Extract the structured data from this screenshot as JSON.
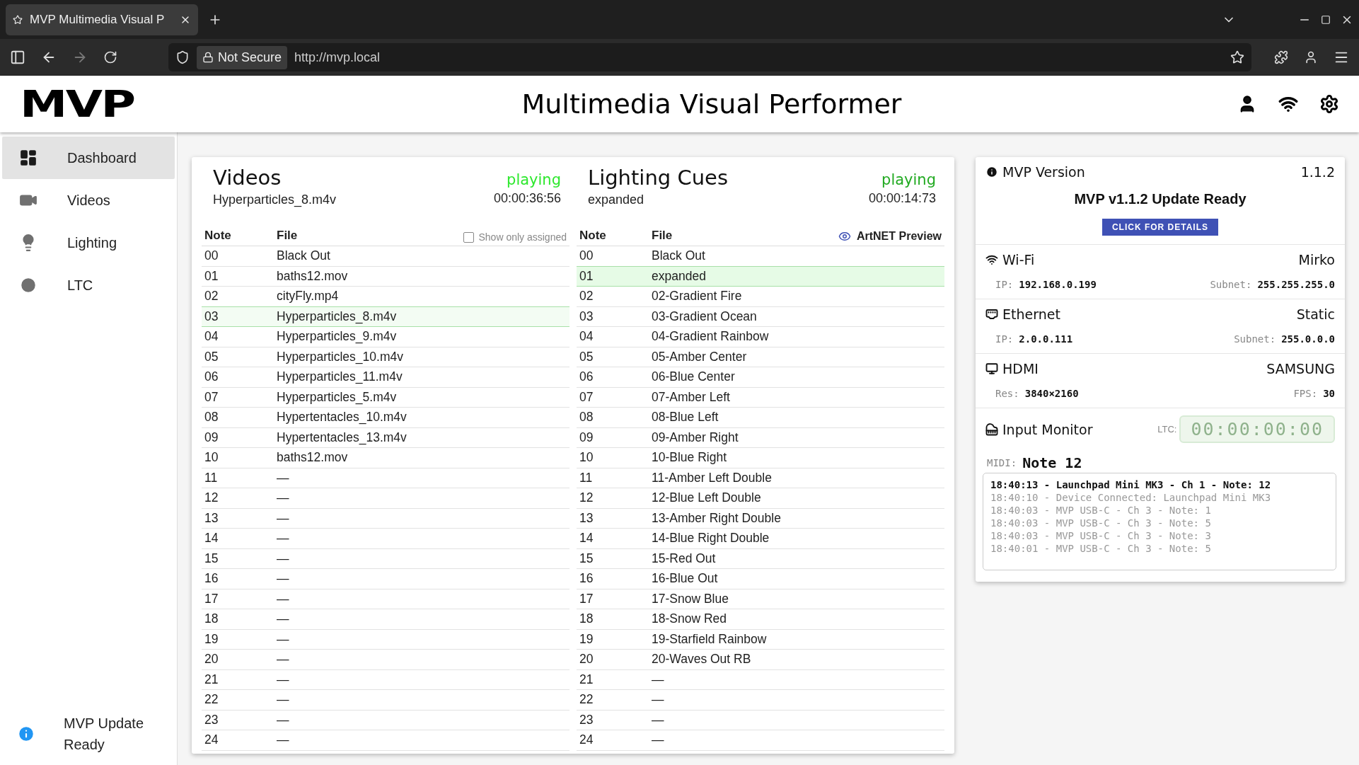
{
  "browser": {
    "tab_title": "MVP Multimedia Visual P",
    "security": "Not Secure",
    "url": "http://mvp.local"
  },
  "header": {
    "logo": "MVP",
    "title": "Multimedia Visual Performer"
  },
  "sidebar": {
    "items": [
      {
        "label": "Dashboard",
        "selected": true
      },
      {
        "label": "Videos",
        "selected": false
      },
      {
        "label": "Lighting",
        "selected": false
      },
      {
        "label": "LTC",
        "selected": false
      }
    ],
    "footer": "MVP Update Ready"
  },
  "videos": {
    "title": "Videos",
    "current": "Hyperparticles_8.m4v",
    "status": "playing",
    "time": "00:00:36:56",
    "columns": [
      "Note",
      "File"
    ],
    "filter": {
      "label": "Show only assigned",
      "checked": false
    },
    "rows": [
      {
        "note": "00",
        "file": "Black Out",
        "selected": false
      },
      {
        "note": "01",
        "file": "baths12.mov",
        "selected": false
      },
      {
        "note": "02",
        "file": "cityFly.mp4",
        "selected": false
      },
      {
        "note": "03",
        "file": "Hyperparticles_8.m4v",
        "selected": true
      },
      {
        "note": "04",
        "file": "Hyperparticles_9.m4v",
        "selected": false
      },
      {
        "note": "05",
        "file": "Hyperparticles_10.m4v",
        "selected": false
      },
      {
        "note": "06",
        "file": "Hyperparticles_11.m4v",
        "selected": false
      },
      {
        "note": "07",
        "file": "Hyperparticles_5.m4v",
        "selected": false
      },
      {
        "note": "08",
        "file": "Hypertentacles_10.m4v",
        "selected": false
      },
      {
        "note": "09",
        "file": "Hypertentacles_13.m4v",
        "selected": false
      },
      {
        "note": "10",
        "file": "baths12.mov",
        "selected": false
      },
      {
        "note": "11",
        "file": "—",
        "selected": false
      },
      {
        "note": "12",
        "file": "—",
        "selected": false
      },
      {
        "note": "13",
        "file": "—",
        "selected": false
      },
      {
        "note": "14",
        "file": "—",
        "selected": false
      },
      {
        "note": "15",
        "file": "—",
        "selected": false
      },
      {
        "note": "16",
        "file": "—",
        "selected": false
      },
      {
        "note": "17",
        "file": "—",
        "selected": false
      },
      {
        "note": "18",
        "file": "—",
        "selected": false
      },
      {
        "note": "19",
        "file": "—",
        "selected": false
      },
      {
        "note": "20",
        "file": "—",
        "selected": false
      },
      {
        "note": "21",
        "file": "—",
        "selected": false
      },
      {
        "note": "22",
        "file": "—",
        "selected": false
      },
      {
        "note": "23",
        "file": "—",
        "selected": false
      },
      {
        "note": "24",
        "file": "—",
        "selected": false
      }
    ]
  },
  "lighting": {
    "title": "Lighting Cues",
    "current": "expanded",
    "status": "playing",
    "time": "00:00:14:73",
    "columns": [
      "Note",
      "File"
    ],
    "preview": "ArtNET Preview",
    "rows": [
      {
        "note": "00",
        "file": "Black Out",
        "selected": false
      },
      {
        "note": "01",
        "file": "expanded",
        "selected": true
      },
      {
        "note": "02",
        "file": "02-Gradient Fire",
        "selected": false
      },
      {
        "note": "03",
        "file": "03-Gradient Ocean",
        "selected": false
      },
      {
        "note": "04",
        "file": "04-Gradient Rainbow",
        "selected": false
      },
      {
        "note": "05",
        "file": "05-Amber Center",
        "selected": false
      },
      {
        "note": "06",
        "file": "06-Blue Center",
        "selected": false
      },
      {
        "note": "07",
        "file": "07-Amber Left",
        "selected": false
      },
      {
        "note": "08",
        "file": "08-Blue Left",
        "selected": false
      },
      {
        "note": "09",
        "file": "09-Amber Right",
        "selected": false
      },
      {
        "note": "10",
        "file": "10-Blue Right",
        "selected": false
      },
      {
        "note": "11",
        "file": "11-Amber Left Double",
        "selected": false
      },
      {
        "note": "12",
        "file": "12-Blue Left Double",
        "selected": false
      },
      {
        "note": "13",
        "file": "13-Amber Right Double",
        "selected": false
      },
      {
        "note": "14",
        "file": "14-Blue Right Double",
        "selected": false
      },
      {
        "note": "15",
        "file": "15-Red Out",
        "selected": false
      },
      {
        "note": "16",
        "file": "16-Blue Out",
        "selected": false
      },
      {
        "note": "17",
        "file": "17-Snow Blue",
        "selected": false
      },
      {
        "note": "18",
        "file": "18-Snow Red",
        "selected": false
      },
      {
        "note": "19",
        "file": "19-Starfield Rainbow",
        "selected": false
      },
      {
        "note": "20",
        "file": "20-Waves Out RB",
        "selected": false
      },
      {
        "note": "21",
        "file": "—",
        "selected": false
      },
      {
        "note": "22",
        "file": "—",
        "selected": false
      },
      {
        "note": "23",
        "file": "—",
        "selected": false
      },
      {
        "note": "24",
        "file": "—",
        "selected": false
      }
    ]
  },
  "status": {
    "version": {
      "label": "MVP Version",
      "value": "1.1.2",
      "notice": "MVP v1.1.2 Update Ready",
      "button": "CLICK FOR DETAILS"
    },
    "networks": [
      {
        "label": "Wi-Fi",
        "value": "Mirko",
        "left_label": "IP:",
        "left_value": "192.168.0.199",
        "right_label": "Subnet:",
        "right_value": "255.255.255.0"
      },
      {
        "label": "Ethernet",
        "value": "Static",
        "left_label": "IP:",
        "left_value": "2.0.0.111",
        "right_label": "Subnet:",
        "right_value": "255.0.0.0"
      },
      {
        "label": "HDMI",
        "value": "SAMSUNG",
        "left_label": "Res:",
        "left_value": "3840×2160",
        "right_label": "FPS:",
        "right_value": "30"
      }
    ],
    "monitor": {
      "label": "Input Monitor",
      "ltc_label": "LTC:",
      "ltc": "00:00:00:00",
      "midi_label": "MIDI:",
      "midi": "Note 12",
      "log": [
        {
          "text": "18:40:13 - Launchpad Mini MK3 - Ch 1 - Note: 12",
          "latest": true
        },
        {
          "text": "18:40:10 - Device Connected: Launchpad Mini MK3",
          "latest": false
        },
        {
          "text": "18:40:03 - MVP USB-C - Ch 3 - Note: 1",
          "latest": false
        },
        {
          "text": "18:40:03 - MVP USB-C - Ch 3 - Note: 5",
          "latest": false
        },
        {
          "text": "18:40:03 - MVP USB-C - Ch 3 - Note: 3",
          "latest": false
        },
        {
          "text": "18:40:01 - MVP USB-C - Ch 3 - Note: 5",
          "latest": false
        }
      ]
    }
  }
}
